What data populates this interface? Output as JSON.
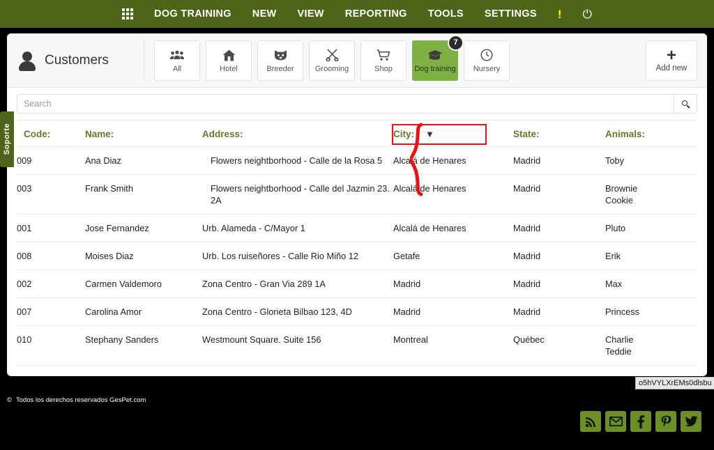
{
  "navbar": {
    "grid_icon": "grid-apps-icon",
    "items": [
      {
        "label": "DOG TRAINING"
      },
      {
        "label": "NEW"
      },
      {
        "label": "VIEW"
      },
      {
        "label": "REPORTING"
      },
      {
        "label": "TOOLS"
      },
      {
        "label": "SETTINGS"
      }
    ],
    "alert_icon": "exclamation-icon",
    "alert_glyph": "!",
    "power_icon": "power-icon",
    "power_glyph": "⏻",
    "bg_color": "#4d6419"
  },
  "support_tab": {
    "label": "Soporte"
  },
  "header": {
    "title": "Customers",
    "person_icon": "person-icon",
    "tabs": [
      {
        "label": "All",
        "icon": "group-users-icon",
        "glyph": "👥",
        "active": false,
        "badge": ""
      },
      {
        "label": "Hotel",
        "icon": "house-icon",
        "glyph": "⌂",
        "active": false,
        "badge": ""
      },
      {
        "label": "Breeder",
        "icon": "dog-face-icon",
        "glyph": "🐶",
        "active": false,
        "badge": ""
      },
      {
        "label": "Grooming",
        "icon": "scissors-icon",
        "glyph": "✂",
        "active": false,
        "badge": ""
      },
      {
        "label": "Shop",
        "icon": "shopping-cart-icon",
        "glyph": "🛒",
        "active": false,
        "badge": ""
      },
      {
        "label": "Dog training",
        "icon": "graduation-cap-icon",
        "glyph": "🎓",
        "active": true,
        "badge": "7"
      },
      {
        "label": "Nursery",
        "icon": "clock-icon",
        "glyph": "🕐",
        "active": false,
        "badge": ""
      }
    ],
    "add_new": {
      "label": "Add new",
      "icon": "plus-icon",
      "glyph": "+"
    },
    "active_color": "#7fb142"
  },
  "search": {
    "placeholder": "Search",
    "value": "",
    "button_icon": "search-icon"
  },
  "table": {
    "columns": [
      {
        "key": "code",
        "label": "Code:"
      },
      {
        "key": "name",
        "label": "Name:"
      },
      {
        "key": "address",
        "label": "Address:"
      },
      {
        "key": "city",
        "label": "City:"
      },
      {
        "key": "state",
        "label": "State:"
      },
      {
        "key": "animals",
        "label": "Animals:"
      }
    ],
    "sorted_column": "City:",
    "sort_arrow_glyph": "▼",
    "highlight_color": "#ee1111",
    "header_color": "#5f7d21",
    "rows": [
      {
        "code": "009",
        "name": "Ana Diaz",
        "address": "Flowers neightborhood - Calle de la Rosa 5",
        "address_indent": 1,
        "city": "Alcalá de Henares",
        "state": "Madrid",
        "animals": [
          "Toby"
        ]
      },
      {
        "code": "003",
        "name": "Frank Smith",
        "address": "Flowers neightborhood - Calle del Jazmin 23. 2A",
        "address_indent": 1,
        "city": "Alcalá de Henares",
        "state": "Madrid",
        "animals": [
          "Brownie",
          "Cookie"
        ]
      },
      {
        "code": "001",
        "name": "Jose Fernandez",
        "address": "Urb. Alameda - C/Mayor 1",
        "address_indent": 0,
        "city": "Alcalá de Henares",
        "state": "Madrid",
        "animals": [
          "Pluto"
        ]
      },
      {
        "code": "008",
        "name": "Moises Diaz",
        "address": "Urb. Los ruiseñores - Calle Rio Miño 12",
        "address_indent": 0,
        "city": "Getafe",
        "state": "Madrid",
        "animals": [
          "Erik"
        ]
      },
      {
        "code": "002",
        "name": "Carmen Valdemoro",
        "address": "Zona Centro - Gran Via 289 1A",
        "address_indent": 0,
        "city": "Madrid",
        "state": "Madrid",
        "animals": [
          "Max"
        ]
      },
      {
        "code": "007",
        "name": "Carolina Amor",
        "address": "Zona Centro - Glorieta Bilbao 123, 4D",
        "address_indent": 0,
        "city": "Madrid",
        "state": "Madrid",
        "animals": [
          "Princess"
        ]
      },
      {
        "code": "010",
        "name": "Stephany Sanders",
        "address": "Westmount Square. Suite 156",
        "address_indent": 0,
        "city": "Montreal",
        "state": "Québec",
        "animals": [
          "Charlie",
          "Teddie"
        ]
      }
    ]
  },
  "annotations": {
    "brace_color": "#ee1111",
    "brace_name": "grouped-rows-brace"
  },
  "footer": {
    "copyright_symbol": "©",
    "copyright": "Todos los derechos reservados GesPet.com",
    "social": [
      {
        "name": "rss-icon",
        "glyph": "rss"
      },
      {
        "name": "email-icon",
        "glyph": "✉"
      },
      {
        "name": "facebook-icon",
        "glyph": "f"
      },
      {
        "name": "pinterest-icon",
        "glyph": "P"
      },
      {
        "name": "twitter-icon",
        "glyph": "t"
      }
    ],
    "social_bg": "#6c9024"
  },
  "tooltip": {
    "text": "o5hVYLXrEMs0dlsbu"
  }
}
